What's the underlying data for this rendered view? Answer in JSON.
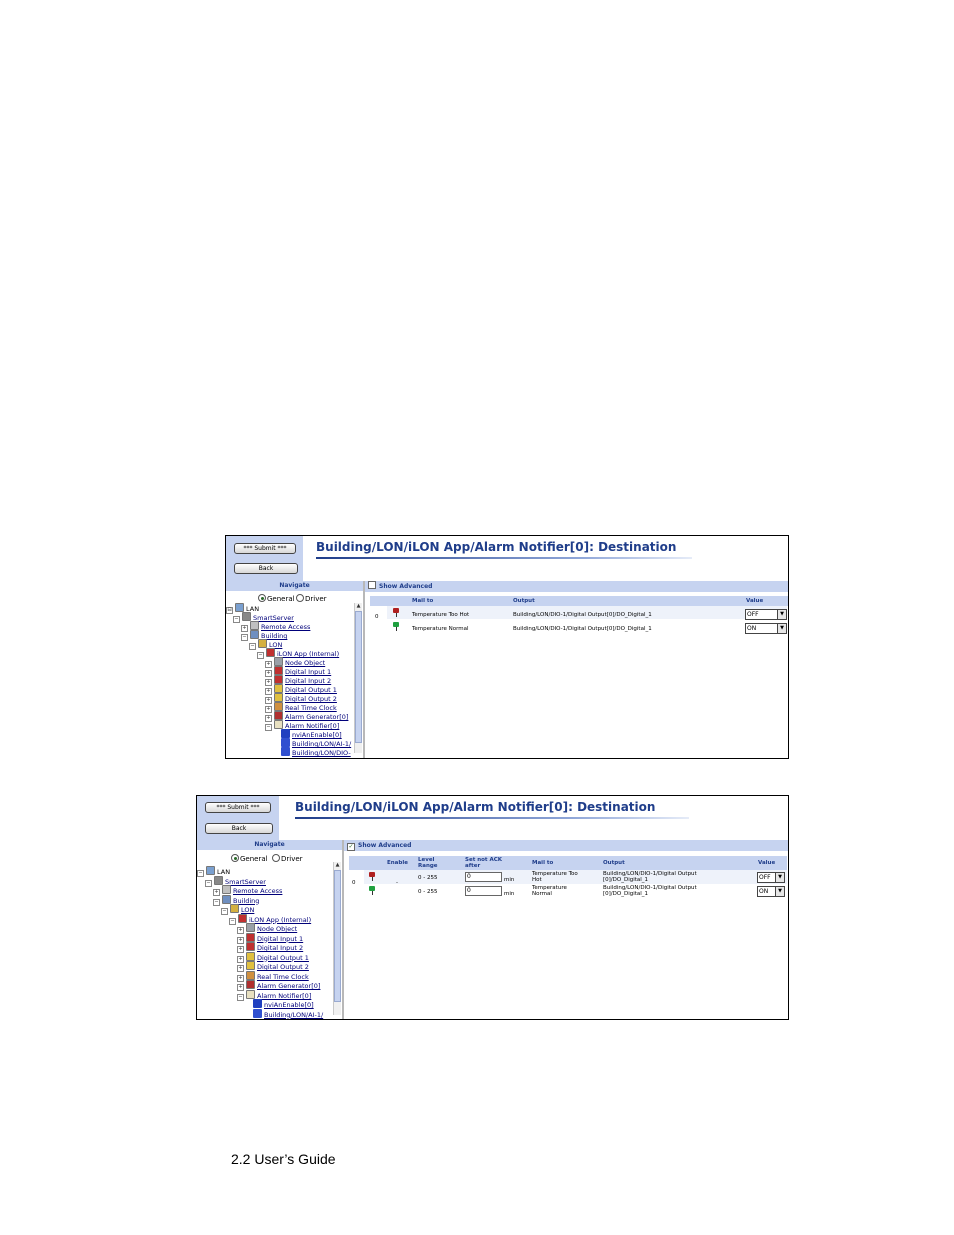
{
  "screenshots": [
    {
      "submit_label": "*** Submit ***",
      "back_label": "Back",
      "title": "Building/LON/iLON App/Alarm Notifier[0]: Destination",
      "navigate_label": "Navigate",
      "radio_general": "General",
      "radio_driver": "Driver",
      "show_advanced_label": "Show Advanced",
      "show_advanced_checked": false,
      "tree": [
        "LAN",
        "SmartServer",
        "Remote Access",
        "Building",
        "LON",
        "iLON App (Internal)",
        "Node Object",
        "Digital Input 1",
        "Digital Input 2",
        "Digital Output 1",
        "Digital Output 2",
        "Real Time Clock",
        "Alarm Generator[0]",
        "Alarm Notifier[0]",
        "nviAnEnable[0]",
        "Building/LON/AI-1/",
        "Building/LON/DIO-"
      ],
      "columns": {
        "mail_to": "Mail to",
        "output": "Output",
        "value": "Value"
      },
      "group_index": "0",
      "rows": [
        {
          "mail_to": "Temperature Too Hot",
          "output": "Building/LON/DIO-1/Digital Output[0]/DO_Digital_1",
          "value": "OFF",
          "pin_color": "#b02020"
        },
        {
          "mail_to": "Temperature Normal",
          "output": "Building/LON/DIO-1/Digital Output[0]/DO_Digital_1",
          "value": "ON",
          "pin_color": "#20a040"
        }
      ]
    },
    {
      "submit_label": "*** Submit ***",
      "back_label": "Back",
      "title": "Building/LON/iLON App/Alarm Notifier[0]: Destination",
      "navigate_label": "Navigate",
      "radio_general": "General",
      "radio_driver": "Driver",
      "show_advanced_label": "Show Advanced",
      "show_advanced_checked": true,
      "tree": [
        "LAN",
        "SmartServer",
        "Remote Access",
        "Building",
        "LON",
        "iLON App (Internal)",
        "Node Object",
        "Digital Input 1",
        "Digital Input 2",
        "Digital Output 1",
        "Digital Output 2",
        "Real Time Clock",
        "Alarm Generator[0]",
        "Alarm Notifier[0]",
        "nviAnEnable[0]",
        "Building/LON/AI-1/"
      ],
      "columns": {
        "enable": "Enable",
        "level_range": "Level Range",
        "ack": "Set not ACK after",
        "mail_to": "Mail to",
        "output": "Output",
        "value": "Value"
      },
      "group_index": "0",
      "enable_value": "-",
      "rows": [
        {
          "level_range": "0 - 255",
          "ack_value": "0",
          "ack_unit": "min",
          "mail_to_1": "Temperature Too",
          "mail_to_2": "Hot",
          "output_1": "Building/LON/DIO-1/Digital Output",
          "output_2": "[0]/DO_Digital_1",
          "value": "OFF",
          "pin_color": "#b02020"
        },
        {
          "level_range": "0 - 255",
          "ack_value": "0",
          "ack_unit": "min",
          "mail_to_1": "Temperature",
          "mail_to_2": "Normal",
          "output_1": "Building/LON/DIO-1/Digital Output",
          "output_2": "[0]/DO_Digital_1",
          "value": "ON",
          "pin_color": "#20a040"
        }
      ]
    }
  ],
  "footer_text": "2.2 User’s Guide"
}
